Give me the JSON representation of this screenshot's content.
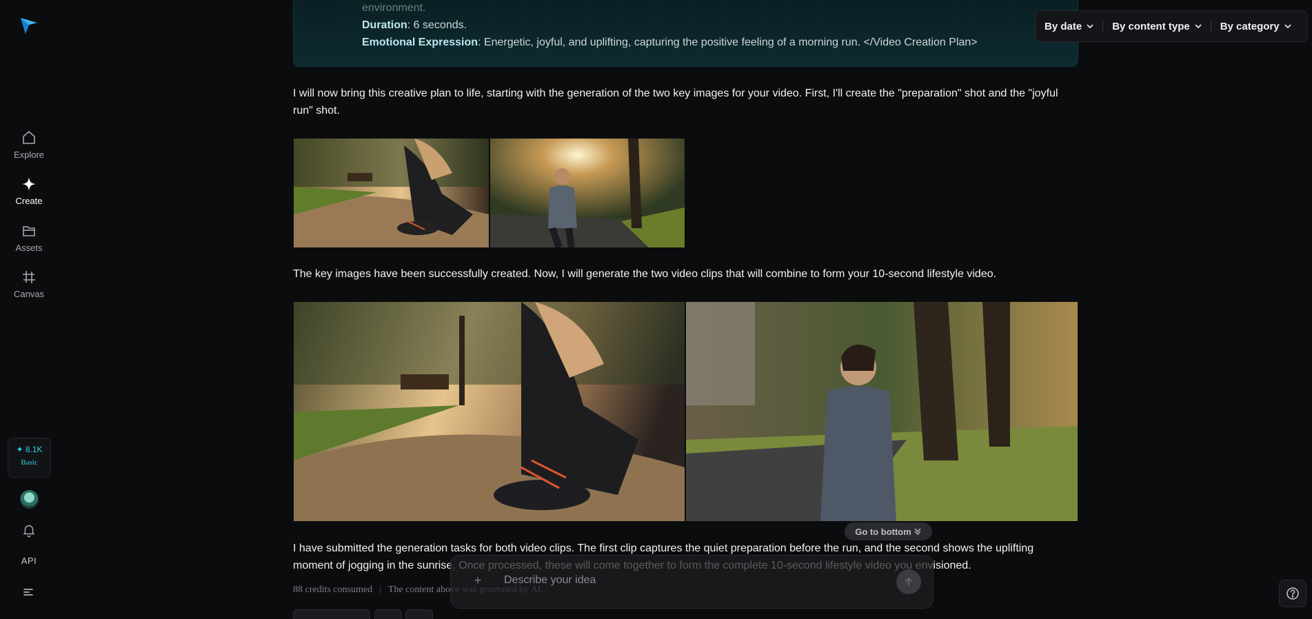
{
  "sidebar": {
    "nav": [
      {
        "label": "Explore",
        "icon": "home-icon"
      },
      {
        "label": "Create",
        "icon": "sparkle-icon"
      },
      {
        "label": "Assets",
        "icon": "folder-icon"
      },
      {
        "label": "Canvas",
        "icon": "crop-icon"
      }
    ],
    "credits": {
      "amount": "✦ 8.1K",
      "plan": "Basic"
    },
    "api_label": "API"
  },
  "plan": {
    "faded_line": "environment.",
    "duration_label": "Duration",
    "duration_value": ": 6 seconds.",
    "emotion_label": "Emotional Expression",
    "emotion_value": ": Energetic, joyful, and uplifting, capturing the positive feeling of a morning run. </Video Creation Plan>"
  },
  "messages": {
    "p1": "I will now bring this creative plan to life, starting with the generation of the two key images for your video. First, I'll create the \"preparation\" shot and the \"joyful run\" shot.",
    "p2": "The key images have been successfully created. Now, I will generate the two video clips that will combine to form your 10-second lifestyle video.",
    "p3": "I have submitted the generation tasks for both video clips. The first clip captures the quiet preparation before the run, and the second shows the uplifting moment of jogging in the sunrise. Once processed, these will come together to form the complete 10-second lifestyle video you envisioned."
  },
  "meta": {
    "credits_consumed": "88 credits consumed",
    "separator": "|",
    "ai_note": "The content above was generated by AI."
  },
  "filters": [
    {
      "label": "By date"
    },
    {
      "label": "By content type"
    },
    {
      "label": "By category"
    }
  ],
  "composer": {
    "go_bottom": "Go to bottom",
    "placeholder": "Describe your idea",
    "plus": "+"
  },
  "colors": {
    "accent": "#35d0e6",
    "background": "#0b0c0e"
  }
}
